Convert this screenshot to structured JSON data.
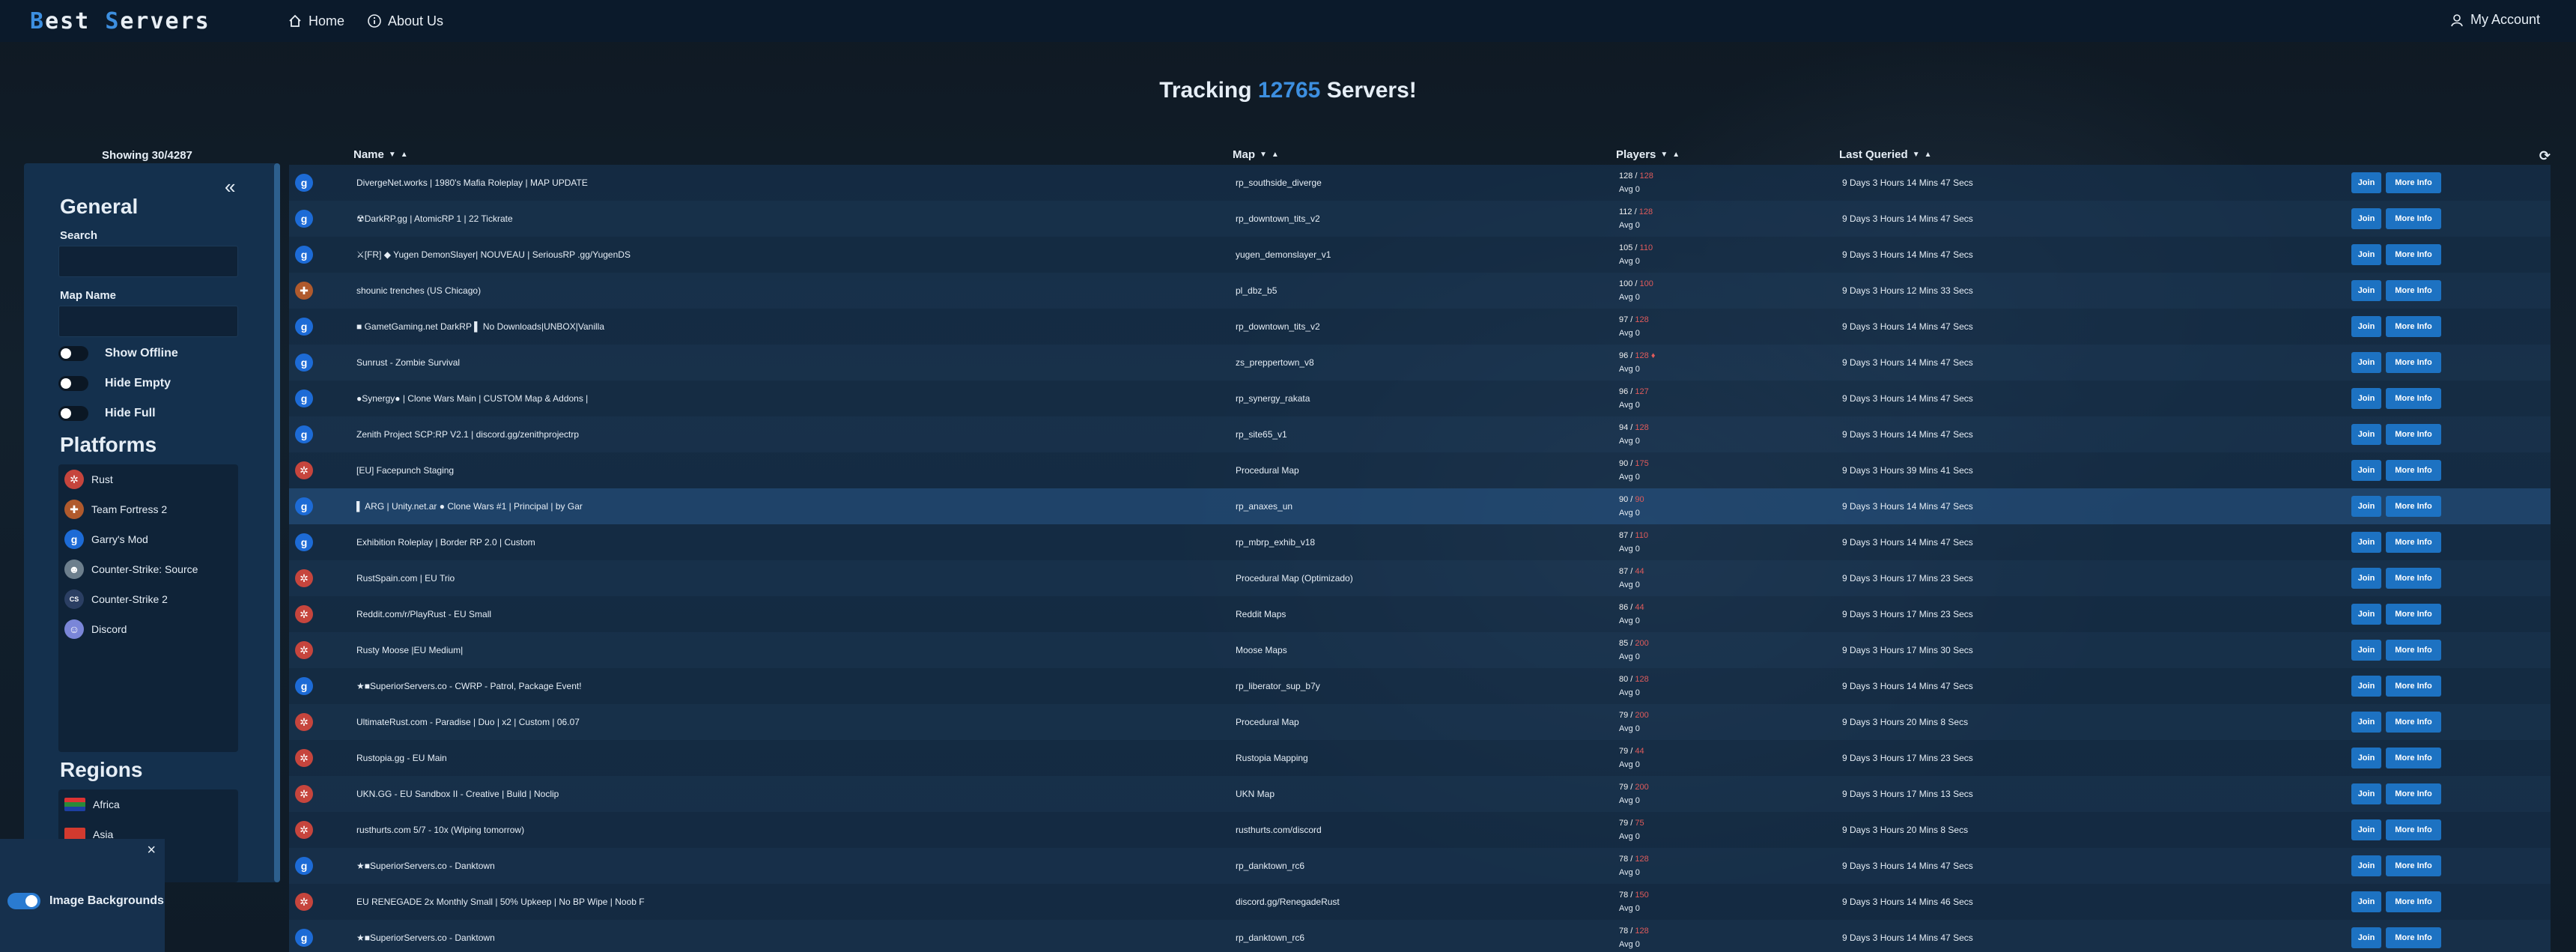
{
  "navbar": {
    "brand_first_letter": "B",
    "brand_first_rest": "est ",
    "brand_second_letter": "S",
    "brand_second_rest": "ervers",
    "home_label": "Home",
    "about_label": "About Us",
    "account_label": "My Account"
  },
  "tracking": {
    "prefix": "Tracking ",
    "count": "12765",
    "suffix": " Servers!"
  },
  "showing": "Showing 30/4287",
  "sidebar": {
    "collapse_symbol": "«",
    "general_title": "General",
    "search_label": "Search",
    "search_value": "",
    "map_label": "Map Name",
    "map_value": "",
    "toggles": [
      "Show Offline",
      "Hide Empty",
      "Hide Full"
    ],
    "platforms_title": "Platforms",
    "platforms": [
      {
        "label": "Rust",
        "icon": "rust-icon"
      },
      {
        "label": "Team Fortress 2",
        "icon": "tf2-icon"
      },
      {
        "label": "Garry's Mod",
        "icon": "gmod-icon"
      },
      {
        "label": "Counter-Strike: Source",
        "icon": "css-icon"
      },
      {
        "label": "Counter-Strike 2",
        "icon": "cs2-icon"
      },
      {
        "label": "Discord",
        "icon": "discord-icon"
      }
    ],
    "regions_title": "Regions",
    "regions": [
      {
        "label": "Africa",
        "icon": "flag-africa-icon"
      },
      {
        "label": "Asia",
        "icon": "flag-asia-icon"
      }
    ]
  },
  "popup": {
    "close_symbol": "×",
    "toggle_label": "Image Backgrounds"
  },
  "table": {
    "headers": {
      "name": "Name",
      "map": "Map",
      "players": "Players",
      "last_queried": "Last Queried"
    },
    "join_label": "Join",
    "info_label": "More Info",
    "rows": [
      {
        "platform": "gmod",
        "name": "DivergeNet.works | 1980's Mafia Roleplay | MAP UPDATE",
        "map": "rp_southside_diverge",
        "cur": "128",
        "max": "128",
        "avg": "Avg 0",
        "queried": "9 Days 3 Hours 14 Mins 47 Secs"
      },
      {
        "platform": "gmod",
        "name": "☢DarkRP.gg | AtomicRP 1 | 22 Tickrate",
        "map": "rp_downtown_tits_v2",
        "cur": "112",
        "max": "128",
        "avg": "Avg 0",
        "queried": "9 Days 3 Hours 14 Mins 47 Secs"
      },
      {
        "platform": "gmod",
        "name": "⚔[FR] ◆ Yugen DemonSlayer| NOUVEAU | SeriousRP .gg/YugenDS",
        "map": "yugen_demonslayer_v1",
        "cur": "105",
        "max": "110",
        "avg": "Avg 0",
        "queried": "9 Days 3 Hours 14 Mins 47 Secs"
      },
      {
        "platform": "tf2",
        "name": "shounic trenches (US Chicago)",
        "map": "pl_dbz_b5",
        "cur": "100",
        "max": "100",
        "avg": "Avg 0",
        "queried": "9 Days 3 Hours 12 Mins 33 Secs"
      },
      {
        "platform": "gmod",
        "name": "■ GametGaming.net DarkRP ▌ No Downloads|UNBOX|Vanilla",
        "map": "rp_downtown_tits_v2",
        "cur": "97",
        "max": "128",
        "avg": "Avg 0",
        "queried": "9 Days 3 Hours 14 Mins 47 Secs"
      },
      {
        "platform": "gmod",
        "name": "Sunrust - Zombie Survival",
        "map": "zs_preppertown_v8",
        "cur": "96",
        "max": "128 ♦",
        "avg": "Avg 0",
        "queried": "9 Days 3 Hours 14 Mins 47 Secs"
      },
      {
        "platform": "gmod",
        "name": "●Synergy● | Clone Wars Main | CUSTOM Map & Addons |",
        "map": "rp_synergy_rakata",
        "cur": "96",
        "max": "127",
        "avg": "Avg 0",
        "queried": "9 Days 3 Hours 14 Mins 47 Secs"
      },
      {
        "platform": "gmod",
        "name": "Zenith Project SCP:RP V2.1 | discord.gg/zenithprojectrp",
        "map": "rp_site65_v1",
        "cur": "94",
        "max": "128",
        "avg": "Avg 0",
        "queried": "9 Days 3 Hours 14 Mins 47 Secs"
      },
      {
        "platform": "rust",
        "name": "[EU] Facepunch Staging",
        "map": "Procedural Map",
        "cur": "90",
        "max": "175",
        "avg": "Avg 0",
        "queried": "9 Days 3 Hours 39 Mins 41 Secs"
      },
      {
        "platform": "gmod",
        "name": "▌ ARG | Unity.net.ar ● Clone Wars #1 | Principal | by Gar",
        "map": "rp_anaxes_un",
        "cur": "90",
        "max": "90",
        "avg": "Avg 0",
        "queried": "9 Days 3 Hours 14 Mins 47 Secs",
        "highlight": true
      },
      {
        "platform": "gmod",
        "name": "Exhibition Roleplay | Border RP 2.0 | Custom",
        "map": "rp_mbrp_exhib_v18",
        "cur": "87",
        "max": "110",
        "avg": "Avg 0",
        "queried": "9 Days 3 Hours 14 Mins 47 Secs"
      },
      {
        "platform": "rust",
        "name": "RustSpain.com | EU Trio",
        "map": "Procedural Map (Optimizado)",
        "cur": "87",
        "max": "44",
        "avg": "Avg 0",
        "queried": "9 Days 3 Hours 17 Mins 23 Secs"
      },
      {
        "platform": "rust",
        "name": "Reddit.com/r/PlayRust - EU Small",
        "map": "Reddit Maps",
        "cur": "86",
        "max": "44",
        "avg": "Avg 0",
        "queried": "9 Days 3 Hours 17 Mins 23 Secs"
      },
      {
        "platform": "rust",
        "name": "Rusty Moose |EU Medium|",
        "map": "Moose Maps",
        "cur": "85",
        "max": "200",
        "avg": "Avg 0",
        "queried": "9 Days 3 Hours 17 Mins 30 Secs"
      },
      {
        "platform": "gmod",
        "name": "★■SuperiorServers.co - CWRP - Patrol, Package Event!",
        "map": "rp_liberator_sup_b7y",
        "cur": "80",
        "max": "128",
        "avg": "Avg 0",
        "queried": "9 Days 3 Hours 14 Mins 47 Secs"
      },
      {
        "platform": "rust",
        "name": "UltimateRust.com - Paradise | Duo | x2 | Custom | 06.07",
        "map": "Procedural Map",
        "cur": "79",
        "max": "200",
        "avg": "Avg 0",
        "queried": "9 Days 3 Hours 20 Mins 8 Secs"
      },
      {
        "platform": "rust",
        "name": "Rustopia.gg - EU Main",
        "map": "Rustopia Mapping",
        "cur": "79",
        "max": "44",
        "avg": "Avg 0",
        "queried": "9 Days 3 Hours 17 Mins 23 Secs"
      },
      {
        "platform": "rust",
        "name": "UKN.GG - EU Sandbox II - Creative | Build | Noclip",
        "map": "UKN Map",
        "cur": "79",
        "max": "200",
        "avg": "Avg 0",
        "queried": "9 Days 3 Hours 17 Mins 13 Secs"
      },
      {
        "platform": "rust",
        "name": "rusthurts.com 5/7 - 10x (Wiping tomorrow)",
        "map": "rusthurts.com/discord",
        "cur": "79",
        "max": "75",
        "avg": "Avg 0",
        "queried": "9 Days 3 Hours 20 Mins 8 Secs"
      },
      {
        "platform": "gmod",
        "name": "★■SuperiorServers.co - Danktown",
        "map": "rp_danktown_rc6",
        "cur": "78",
        "max": "128",
        "avg": "Avg 0",
        "queried": "9 Days 3 Hours 14 Mins 47 Secs"
      },
      {
        "platform": "rust",
        "name": "EU RENEGADE 2x Monthly Small | 50% Upkeep | No BP Wipe | Noob F",
        "map": "discord.gg/RenegadeRust",
        "cur": "78",
        "max": "150",
        "avg": "Avg 0",
        "queried": "9 Days 3 Hours 14 Mins 46 Secs"
      },
      {
        "platform": "gmod",
        "name": "★■SuperiorServers.co - Danktown",
        "map": "rp_danktown_rc6",
        "cur": "78",
        "max": "128",
        "avg": "Avg 0",
        "queried": "9 Days 3 Hours 14 Mins 47 Secs"
      }
    ]
  },
  "colors": {
    "accent": "#3d8fe0",
    "button": "#1d72c2",
    "full": "#e05b5b"
  }
}
